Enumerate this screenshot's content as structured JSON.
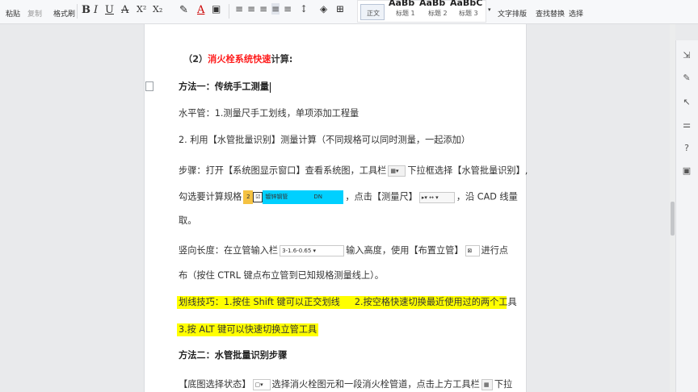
{
  "toolbar": {
    "paste": "粘贴",
    "copy": "复制",
    "format_painter": "格式刷",
    "bold": "B",
    "italic": "I",
    "underline": "U",
    "strike": "A",
    "superscript": "X²",
    "subscript": "X₂",
    "styles": {
      "previews": [
        "AaBb",
        "AaBb",
        "AaBbC"
      ],
      "normal": "正文",
      "heading1": "标题 1",
      "heading2": "标题 2",
      "heading3": "标题 3"
    },
    "text_layout": "文字排版",
    "find_replace": "查找替换",
    "select": "选择"
  },
  "document": {
    "heading_prefix": "（2）",
    "heading_red": "消火栓系统快速",
    "heading_suffix": "计算:",
    "method1_title": "方法一：传统手工测量",
    "line_horizontal": "水平管：1.测量尺手工划线，单项添加工程量",
    "line_batch": "2. 利用【水管批量识别】测量计算（不同规格可以同时测量，一起添加）",
    "steps_a": "步骤：打开【系统图显示窗口】查看系统图，工具栏",
    "steps_a_after": "下拉框选择【水管批量识别】,",
    "steps_b_pre": "勾选要计算规格",
    "inline_spec_num": "2",
    "inline_spec_label": "镀锌钢管",
    "inline_spec_dn": "DN",
    "steps_b_post": "，点击【测量尺】",
    "steps_b_end": "，沿 CAD 线量",
    "steps_c": "取。",
    "vertical_a": "竖向长度：在立管输入栏",
    "vertical_input": "3-1.6-0.65",
    "vertical_a_post": "输入高度，使用【布置立管】",
    "vertical_a_end": "进行点",
    "vertical_b": "布（按住 CTRL 键点布立管到已知规格测量线上）。",
    "tip1_a": "划线技巧：1.按住 Shift 键可以正交划线",
    "tip1_b": "2.按空格快速切换最近使用过的两个工具",
    "tip2": "3.按 ALT 键可以快速切换立管工具",
    "method2_title": "方法二：水管批量识别步骤",
    "last_a": "【底图选择状态】",
    "last_b": "选择消火栓图元和一段消火栓管道，点击上方工具栏",
    "last_c": "下拉"
  },
  "colors": {
    "heading_red": "#ff1d1d",
    "highlight": "#ffff00",
    "spec_highlight": "#00d0ff"
  }
}
